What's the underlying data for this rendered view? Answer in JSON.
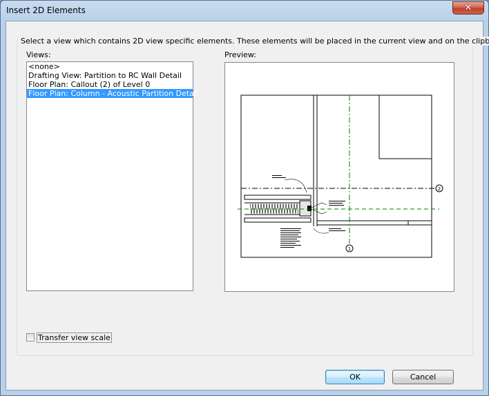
{
  "window": {
    "title": "Insert 2D Elements",
    "close_glyph": "✕"
  },
  "instruction": "Select a view which contains 2D view specific elements.  These elements will be placed in the current view and on the clipboard.",
  "views": {
    "label": "Views:",
    "items": [
      {
        "label": "<none>",
        "selected": false
      },
      {
        "label": "Drafting View: Partition to RC Wall Detail",
        "selected": false
      },
      {
        "label": "Floor Plan: Callout (2) of Level 0",
        "selected": false
      },
      {
        "label": "Floor Plan: Column - Acoustic Partition Detail",
        "selected": true
      }
    ]
  },
  "preview": {
    "label": "Preview:",
    "grid_markers": [
      "2",
      "1"
    ],
    "colors": {
      "grid_line": "#008000",
      "drawing": "#000000"
    }
  },
  "transfer_scale": {
    "label": "Transfer view scale",
    "checked": false
  },
  "buttons": {
    "ok": "OK",
    "cancel": "Cancel"
  }
}
